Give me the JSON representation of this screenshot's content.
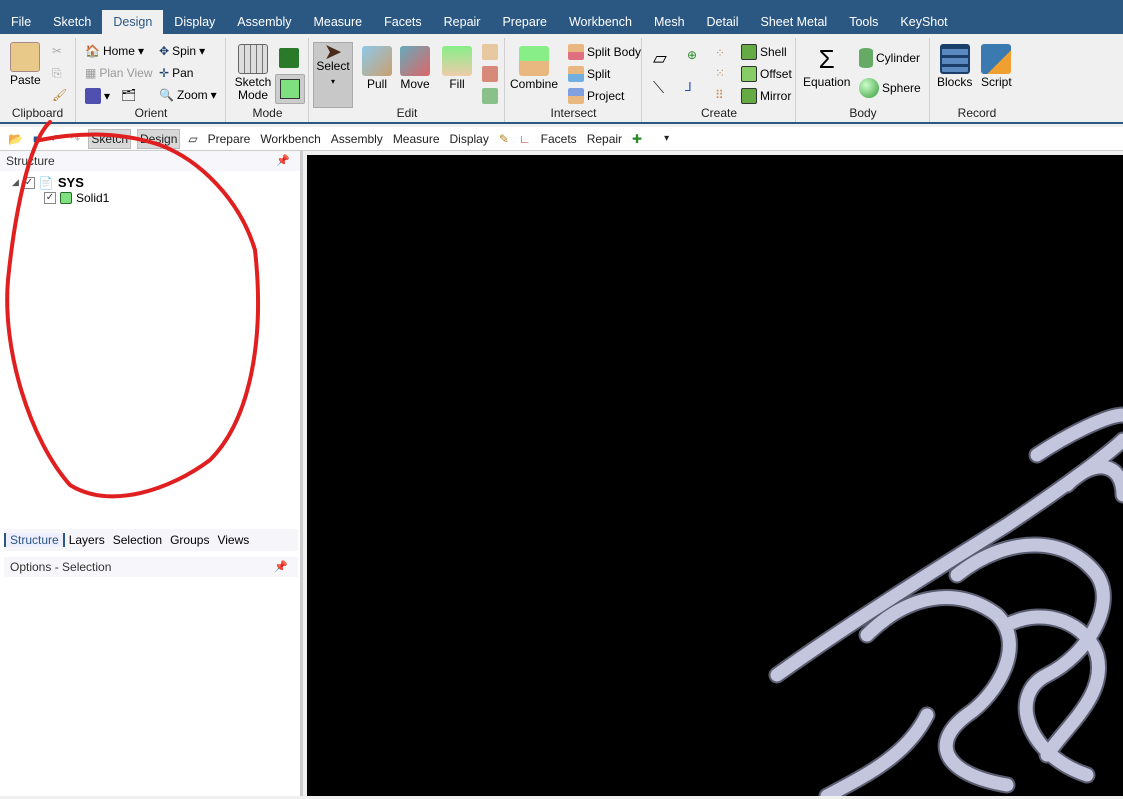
{
  "tabs": [
    "File",
    "Sketch",
    "Design",
    "Display",
    "Assembly",
    "Measure",
    "Facets",
    "Repair",
    "Prepare",
    "Workbench",
    "Mesh",
    "Detail",
    "Sheet Metal",
    "Tools",
    "KeyShot"
  ],
  "ribbon": {
    "clipboard": {
      "label": "Clipboard",
      "paste": "Paste"
    },
    "orient": {
      "label": "Orient",
      "home": "Home",
      "spin": "Spin",
      "plan_view": "Plan View",
      "pan": "Pan",
      "zoom": "Zoom"
    },
    "mode": {
      "label": "Mode",
      "sketch_mode": "Sketch Mode"
    },
    "edit": {
      "label": "Edit",
      "select": "Select",
      "pull": "Pull",
      "move": "Move",
      "fill": "Fill"
    },
    "intersect": {
      "label": "Intersect",
      "combine": "Combine",
      "split_body": "Split Body",
      "split": "Split",
      "project": "Project"
    },
    "create": {
      "label": "Create",
      "shell": "Shell",
      "offset": "Offset",
      "mirror": "Mirror"
    },
    "body": {
      "label": "Body",
      "equation": "Equation",
      "cylinder": "Cylinder",
      "sphere": "Sphere"
    },
    "record": {
      "label": "Record",
      "blocks": "Blocks",
      "script": "Script"
    }
  },
  "qat": {
    "sketch": "Sketch",
    "design": "Design",
    "prepare": "Prepare",
    "workbench": "Workbench",
    "assembly": "Assembly",
    "measure": "Measure",
    "display": "Display",
    "facets": "Facets",
    "repair": "Repair"
  },
  "structure": {
    "title": "Structure",
    "root": "SYS",
    "child": "Solid1"
  },
  "bottom_tabs": [
    "Structure",
    "Layers",
    "Selection",
    "Groups",
    "Views"
  ],
  "options": {
    "title": "Options - Selection"
  },
  "colors": {
    "accent": "#2b5783",
    "annotation": "#e02020",
    "model": "#c3c6dc"
  }
}
